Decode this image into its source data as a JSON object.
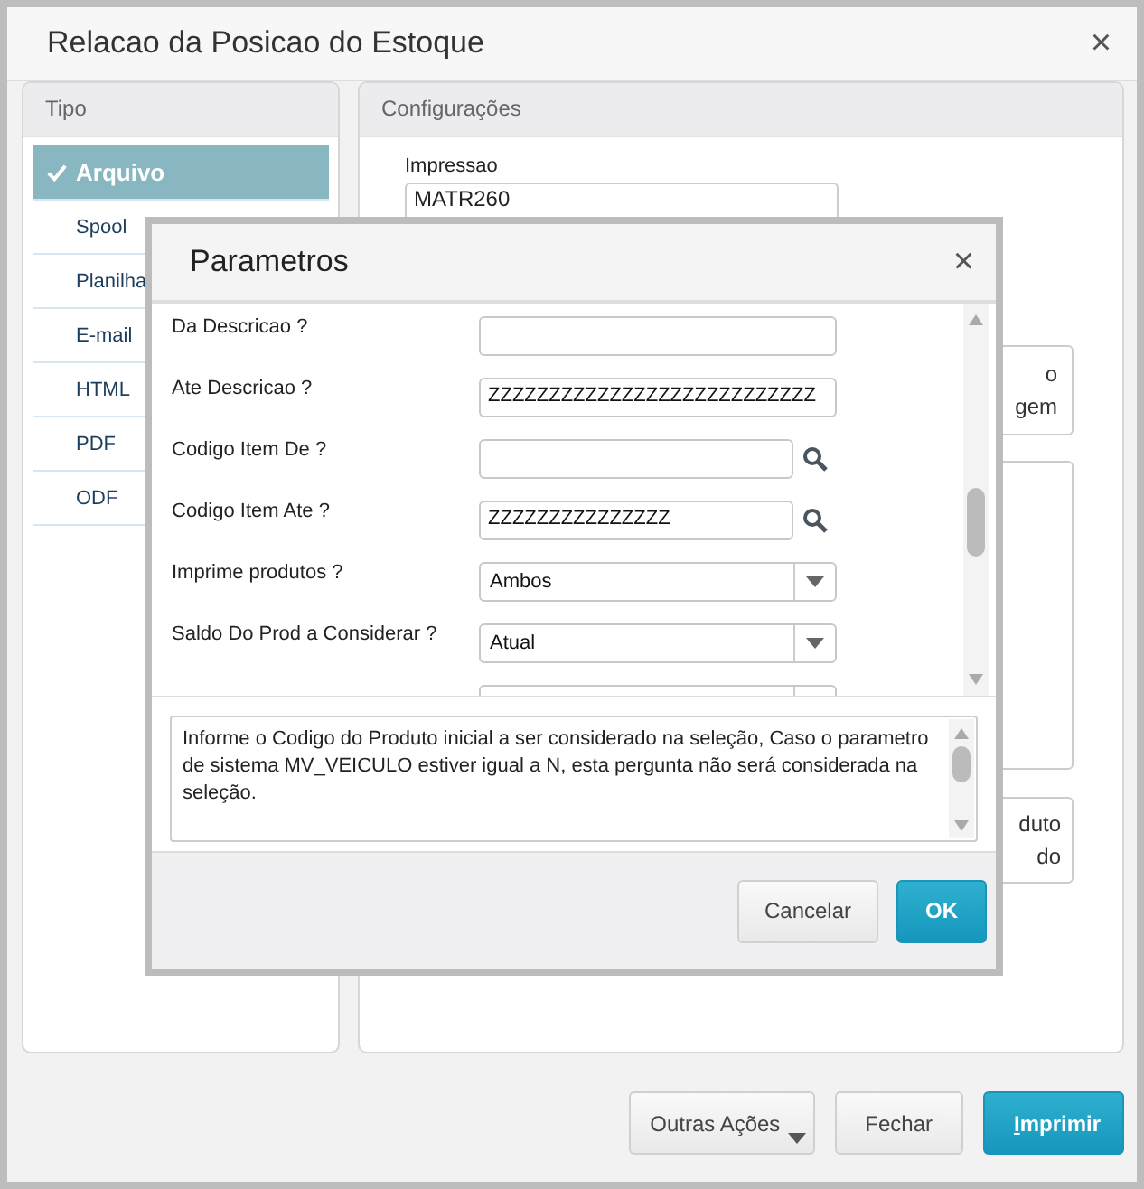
{
  "window": {
    "title": "Relacao da Posicao do Estoque",
    "close": "×"
  },
  "tipo_panel": {
    "title": "Tipo",
    "items": [
      {
        "label": "Arquivo",
        "selected": true
      },
      {
        "label": "Spool",
        "selected": false
      },
      {
        "label": "Planilha",
        "selected": false
      },
      {
        "label": "E-mail",
        "selected": false
      },
      {
        "label": "HTML",
        "selected": false
      },
      {
        "label": "PDF",
        "selected": false
      },
      {
        "label": "ODF",
        "selected": false
      }
    ]
  },
  "config_panel": {
    "title": "Configurações",
    "impressao_label": "Impressao",
    "impressao_value": "MATR260",
    "option_boxes": [
      {
        "kind": "text",
        "lines": [
          "o",
          "gem"
        ]
      },
      {
        "kind": "blank"
      },
      {
        "kind": "text",
        "lines": [
          "duto",
          "do"
        ]
      }
    ]
  },
  "dialog": {
    "title": "Parametros",
    "close": "×",
    "params": [
      {
        "label": "Da Descricao ?",
        "kind": "text"
      },
      {
        "label": "Ate Descricao ?",
        "kind": "text",
        "value": "ZZZZZZZZZZZZZZZZZZZZZZZZZZZ"
      },
      {
        "label": "Codigo Item De ?",
        "kind": "lookup"
      },
      {
        "label": "Codigo Item Ate ?",
        "kind": "lookup",
        "value": "ZZZZZZZZZZZZZZZ"
      },
      {
        "label": "Imprime produtos ?",
        "kind": "select",
        "value": "Ambos"
      },
      {
        "label": "Saldo Do Prod a Considerar ?",
        "kind": "select",
        "value": "Atual"
      },
      {
        "kind": "select"
      }
    ],
    "help": "Informe o Codigo do Produto inicial a ser considerado na seleção, Caso o parametro de sistema MV_VEICULO estiver igual a N, esta pergunta não será considerada na seleção.",
    "buttons": [
      {
        "label": "Cancelar",
        "kind": "secondary"
      },
      {
        "label": "OK",
        "kind": "primary"
      }
    ]
  },
  "footer_buttons": [
    {
      "label": "Outras Ações",
      "kind": "menu"
    },
    {
      "label": "Fechar",
      "kind": "secondary"
    },
    {
      "label": "Imprimir",
      "kind": "primary"
    }
  ]
}
